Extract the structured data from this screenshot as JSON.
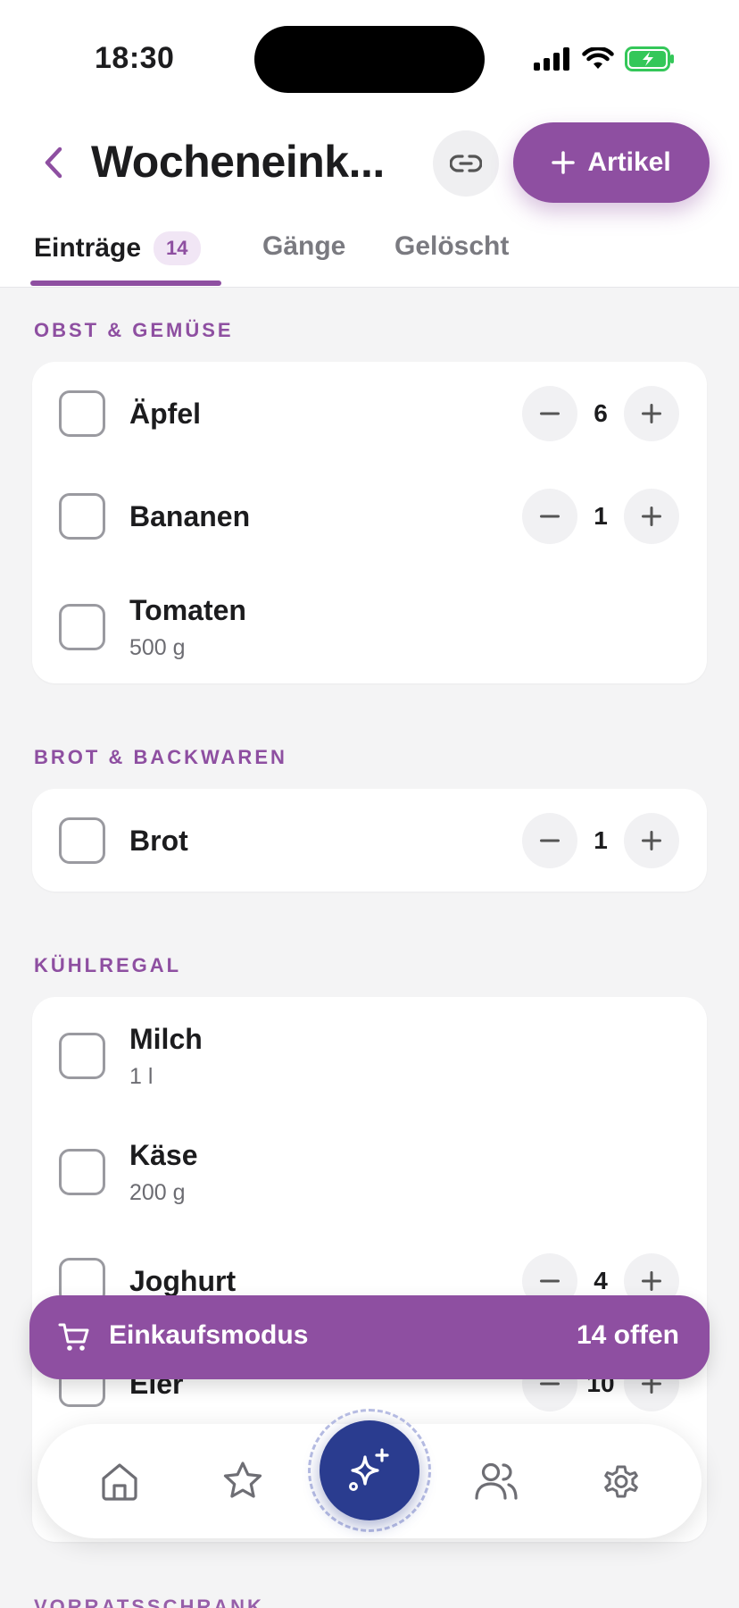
{
  "status_bar": {
    "time": "18:30"
  },
  "header": {
    "title": "Wocheneink...",
    "add_label": "Artikel"
  },
  "tabs": [
    {
      "label": "Einträge",
      "badge": "14"
    },
    {
      "label": "Gänge"
    },
    {
      "label": "Gelöscht"
    }
  ],
  "sections": [
    {
      "title": "OBST & GEMÜSE",
      "items": [
        {
          "name": "Äpfel",
          "qty": "6"
        },
        {
          "name": "Bananen",
          "qty": "1"
        },
        {
          "name": "Tomaten",
          "detail": "500 g"
        }
      ]
    },
    {
      "title": "BROT & BACKWAREN",
      "items": [
        {
          "name": "Brot",
          "qty": "1"
        }
      ]
    },
    {
      "title": "KÜHLREGAL",
      "items": [
        {
          "name": "Milch",
          "detail": "1 l"
        },
        {
          "name": "Käse",
          "detail": "200 g"
        },
        {
          "name": "Joghurt",
          "qty": "4"
        },
        {
          "name": "Eier",
          "qty": "10"
        }
      ]
    },
    {
      "title": "VORRATSSCHRANK"
    }
  ],
  "shopping_bar": {
    "label": "Einkaufsmodus",
    "count": "14 offen"
  },
  "bottom_nav": {
    "items": [
      "home-icon",
      "star-icon",
      "sparkles-icon",
      "users-icon",
      "gear-icon"
    ]
  },
  "colors": {
    "accent": "#8e4fa1",
    "fab": "#2a3c8f",
    "battery": "#34c759"
  }
}
